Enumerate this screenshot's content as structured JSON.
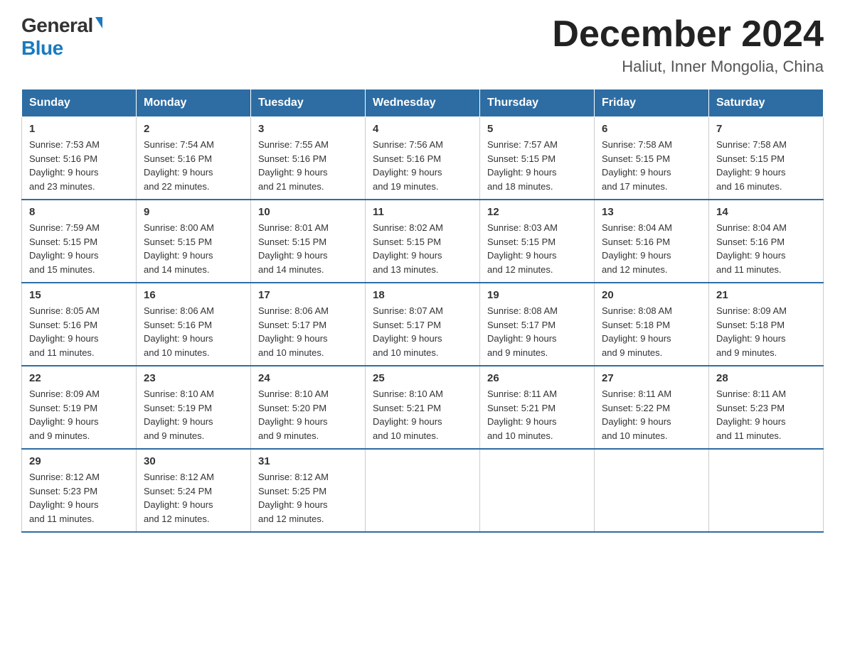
{
  "logo": {
    "general": "General",
    "blue": "Blue"
  },
  "title": "December 2024",
  "location": "Haliut, Inner Mongolia, China",
  "days_of_week": [
    "Sunday",
    "Monday",
    "Tuesday",
    "Wednesday",
    "Thursday",
    "Friday",
    "Saturday"
  ],
  "weeks": [
    [
      {
        "day": "1",
        "sunrise": "7:53 AM",
        "sunset": "5:16 PM",
        "daylight": "9 hours and 23 minutes."
      },
      {
        "day": "2",
        "sunrise": "7:54 AM",
        "sunset": "5:16 PM",
        "daylight": "9 hours and 22 minutes."
      },
      {
        "day": "3",
        "sunrise": "7:55 AM",
        "sunset": "5:16 PM",
        "daylight": "9 hours and 21 minutes."
      },
      {
        "day": "4",
        "sunrise": "7:56 AM",
        "sunset": "5:16 PM",
        "daylight": "9 hours and 19 minutes."
      },
      {
        "day": "5",
        "sunrise": "7:57 AM",
        "sunset": "5:15 PM",
        "daylight": "9 hours and 18 minutes."
      },
      {
        "day": "6",
        "sunrise": "7:58 AM",
        "sunset": "5:15 PM",
        "daylight": "9 hours and 17 minutes."
      },
      {
        "day": "7",
        "sunrise": "7:58 AM",
        "sunset": "5:15 PM",
        "daylight": "9 hours and 16 minutes."
      }
    ],
    [
      {
        "day": "8",
        "sunrise": "7:59 AM",
        "sunset": "5:15 PM",
        "daylight": "9 hours and 15 minutes."
      },
      {
        "day": "9",
        "sunrise": "8:00 AM",
        "sunset": "5:15 PM",
        "daylight": "9 hours and 14 minutes."
      },
      {
        "day": "10",
        "sunrise": "8:01 AM",
        "sunset": "5:15 PM",
        "daylight": "9 hours and 14 minutes."
      },
      {
        "day": "11",
        "sunrise": "8:02 AM",
        "sunset": "5:15 PM",
        "daylight": "9 hours and 13 minutes."
      },
      {
        "day": "12",
        "sunrise": "8:03 AM",
        "sunset": "5:15 PM",
        "daylight": "9 hours and 12 minutes."
      },
      {
        "day": "13",
        "sunrise": "8:04 AM",
        "sunset": "5:16 PM",
        "daylight": "9 hours and 12 minutes."
      },
      {
        "day": "14",
        "sunrise": "8:04 AM",
        "sunset": "5:16 PM",
        "daylight": "9 hours and 11 minutes."
      }
    ],
    [
      {
        "day": "15",
        "sunrise": "8:05 AM",
        "sunset": "5:16 PM",
        "daylight": "9 hours and 11 minutes."
      },
      {
        "day": "16",
        "sunrise": "8:06 AM",
        "sunset": "5:16 PM",
        "daylight": "9 hours and 10 minutes."
      },
      {
        "day": "17",
        "sunrise": "8:06 AM",
        "sunset": "5:17 PM",
        "daylight": "9 hours and 10 minutes."
      },
      {
        "day": "18",
        "sunrise": "8:07 AM",
        "sunset": "5:17 PM",
        "daylight": "9 hours and 10 minutes."
      },
      {
        "day": "19",
        "sunrise": "8:08 AM",
        "sunset": "5:17 PM",
        "daylight": "9 hours and 9 minutes."
      },
      {
        "day": "20",
        "sunrise": "8:08 AM",
        "sunset": "5:18 PM",
        "daylight": "9 hours and 9 minutes."
      },
      {
        "day": "21",
        "sunrise": "8:09 AM",
        "sunset": "5:18 PM",
        "daylight": "9 hours and 9 minutes."
      }
    ],
    [
      {
        "day": "22",
        "sunrise": "8:09 AM",
        "sunset": "5:19 PM",
        "daylight": "9 hours and 9 minutes."
      },
      {
        "day": "23",
        "sunrise": "8:10 AM",
        "sunset": "5:19 PM",
        "daylight": "9 hours and 9 minutes."
      },
      {
        "day": "24",
        "sunrise": "8:10 AM",
        "sunset": "5:20 PM",
        "daylight": "9 hours and 9 minutes."
      },
      {
        "day": "25",
        "sunrise": "8:10 AM",
        "sunset": "5:21 PM",
        "daylight": "9 hours and 10 minutes."
      },
      {
        "day": "26",
        "sunrise": "8:11 AM",
        "sunset": "5:21 PM",
        "daylight": "9 hours and 10 minutes."
      },
      {
        "day": "27",
        "sunrise": "8:11 AM",
        "sunset": "5:22 PM",
        "daylight": "9 hours and 10 minutes."
      },
      {
        "day": "28",
        "sunrise": "8:11 AM",
        "sunset": "5:23 PM",
        "daylight": "9 hours and 11 minutes."
      }
    ],
    [
      {
        "day": "29",
        "sunrise": "8:12 AM",
        "sunset": "5:23 PM",
        "daylight": "9 hours and 11 minutes."
      },
      {
        "day": "30",
        "sunrise": "8:12 AM",
        "sunset": "5:24 PM",
        "daylight": "9 hours and 12 minutes."
      },
      {
        "day": "31",
        "sunrise": "8:12 AM",
        "sunset": "5:25 PM",
        "daylight": "9 hours and 12 minutes."
      },
      null,
      null,
      null,
      null
    ]
  ]
}
